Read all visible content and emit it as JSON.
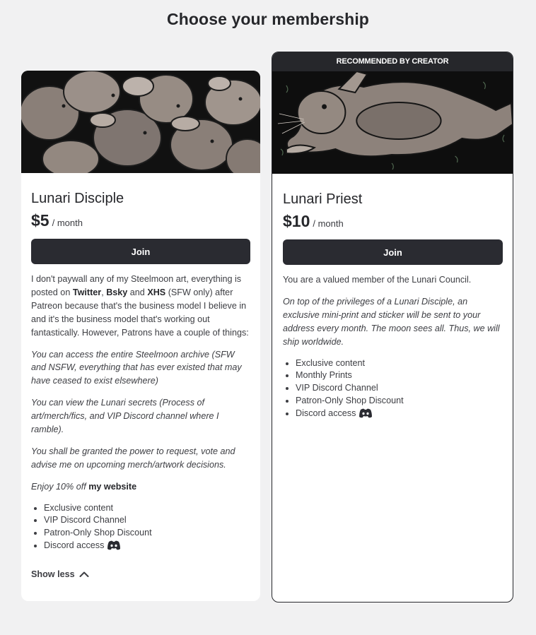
{
  "page": {
    "title": "Choose your membership"
  },
  "tiers": [
    {
      "image_alt": "",
      "name": "Lunari Disciple",
      "price": "$5",
      "period": "/ month",
      "join_label": "Join",
      "description": {
        "p1_text_1": "I don't paywall any of my Steelmoon art, everything is posted on ",
        "p1_link_1": "Twitter",
        "p1_sep_1": ", ",
        "p1_link_2": "Bsky",
        "p1_sep_2": " and ",
        "p1_link_3": "XHS",
        "p1_text_2": " (SFW only) after Patreon because that's the business model I believe in and it's the business model that's working out fantastically. However, Patrons have a couple of things:",
        "p2": "You can access the entire Steelmoon archive (SFW and NSFW, everything that has ever existed that may have ceased to exist elsewhere)",
        "p3": "You can view the Lunari secrets (Process of art/merch/fics, and VIP Discord channel where I ramble).",
        "p4": "You shall be granted the power to request, vote and advise me on upcoming merch/artwork decisions.",
        "p5_text": "Enjoy 10% off ",
        "p5_link": "my website"
      },
      "benefits": [
        "Exclusive content",
        "VIP Discord Channel",
        "Patron-Only Shop Discount",
        "Discord access"
      ],
      "show_less_label": "Show less"
    },
    {
      "banner": "RECOMMENDED BY CREATOR",
      "name": "Lunari Priest",
      "price": "$10",
      "period": "/ month",
      "join_label": "Join",
      "description": {
        "p1": "You are a valued member of the Lunari Council.",
        "p2": "On top of the privileges of a Lunari Disciple, an exclusive mini-print and sticker will be sent to your address every month. The moon sees all. Thus, we will ship worldwide."
      },
      "benefits": [
        "Exclusive content",
        "Monthly Prints",
        "VIP Discord Channel",
        "Patron-Only Shop Discount",
        "Discord access"
      ]
    }
  ],
  "colors": {
    "background": "#f1f1f2",
    "button": "#2a2b31",
    "text": "#26272b",
    "card": "#ffffff"
  },
  "icons": {
    "discord": "discord-icon",
    "chevron": "chevron-up-icon"
  }
}
